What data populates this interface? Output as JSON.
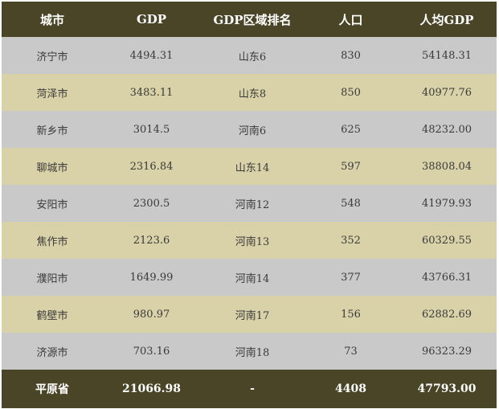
{
  "table": {
    "headers": [
      "城市",
      "GDP",
      "GDP区域排名",
      "人口",
      "人均GDP"
    ],
    "rows": [
      [
        "济宁市",
        "4494.31",
        "山东6",
        "830",
        "54148.31"
      ],
      [
        "菏泽市",
        "3483.11",
        "山东8",
        "850",
        "40977.76"
      ],
      [
        "新乡市",
        "3014.5",
        "河南6",
        "625",
        "48232.00"
      ],
      [
        "聊城市",
        "2316.84",
        "山东14",
        "597",
        "38808.04"
      ],
      [
        "安阳市",
        "2300.5",
        "河南12",
        "548",
        "41979.93"
      ],
      [
        "焦作市",
        "2123.6",
        "河南13",
        "352",
        "60329.55"
      ],
      [
        "濮阳市",
        "1649.99",
        "河南14",
        "377",
        "43766.31"
      ],
      [
        "鹤壁市",
        "980.97",
        "河南17",
        "156",
        "62882.69"
      ],
      [
        "济源市",
        "703.16",
        "河南18",
        "73",
        "96323.29"
      ]
    ],
    "footer": [
      "平原省",
      "21066.98",
      "-",
      "4408",
      "47793.00"
    ]
  },
  "colors": {
    "header_bg": "#4a4526",
    "row_gray": "#c9c9c9",
    "row_tan": "#d9d1a8",
    "header_text": "#ffffff"
  }
}
